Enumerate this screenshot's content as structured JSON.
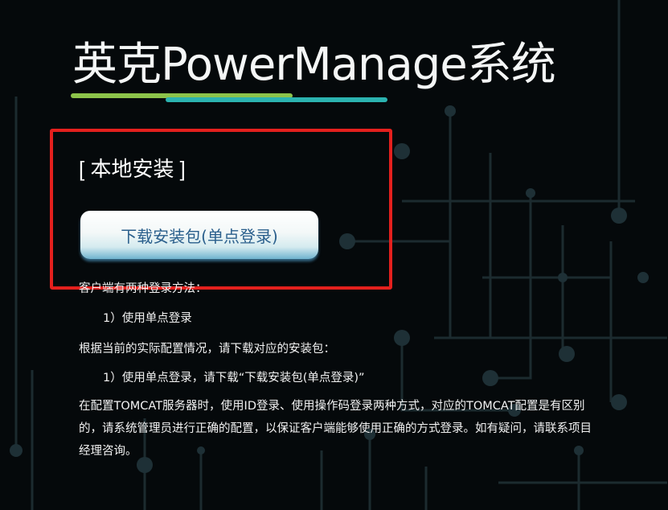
{
  "page": {
    "title": "英克PowerManage系统",
    "section_heading": "[ 本地安装 ]",
    "download_button_label": "下载安装包(单点登录)"
  },
  "info": {
    "login_methods_intro": "客户端有两种登录方法：",
    "login_method_1": "1）使用单点登录",
    "download_instruction": "根据当前的实际配置情况，请下载对应的安装包：",
    "download_option_1": "1）使用单点登录，请下载“下载安装包(单点登录)”",
    "tomcat_note": "在配置TOMCAT服务器时，使用ID登录、使用操作码登录两种方式，对应的TOMCAT配置是有区别的，请系统管理员进行正确的配置，以保证客户端能够使用正确的方式登录。如有疑问，请联系项目经理咨询。"
  },
  "colors": {
    "background": "#05090b",
    "underline_green": "#8cc34a",
    "underline_cyan": "#2bb3b0",
    "highlight_border": "#e4201d",
    "button_text": "#2a5f8c"
  }
}
